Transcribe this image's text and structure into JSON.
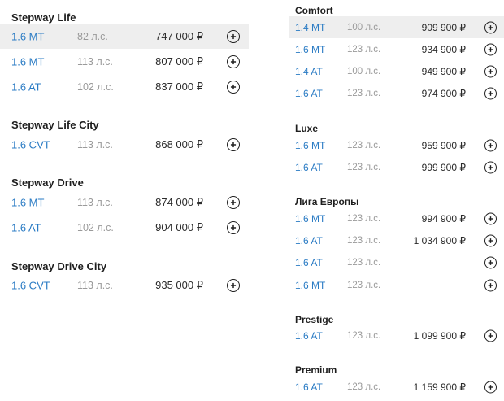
{
  "left_groups": [
    {
      "title": "Stepway Life",
      "rows": [
        {
          "engine": "1.6 MT",
          "power": "82 л.с.",
          "price": "747 000 ₽",
          "highlighted": true
        },
        {
          "engine": "1.6 MT",
          "power": "113 л.с.",
          "price": "807 000 ₽"
        },
        {
          "engine": "1.6 AT",
          "power": "102 л.с.",
          "price": "837 000 ₽"
        }
      ]
    },
    {
      "title": "Stepway Life City",
      "rows": [
        {
          "engine": "1.6 CVT",
          "power": "113 л.с.",
          "price": "868 000 ₽"
        }
      ]
    },
    {
      "title": "Stepway Drive",
      "rows": [
        {
          "engine": "1.6 MT",
          "power": "113 л.с.",
          "price": "874 000 ₽"
        },
        {
          "engine": "1.6 AT",
          "power": "102 л.с.",
          "price": "904 000 ₽"
        }
      ]
    },
    {
      "title": "Stepway Drive City",
      "rows": [
        {
          "engine": "1.6 CVT",
          "power": "113 л.с.",
          "price": "935 000 ₽"
        }
      ]
    }
  ],
  "right_groups": [
    {
      "title": "Comfort",
      "rows": [
        {
          "engine": "1.4 MT",
          "power": "100 л.с.",
          "price": "909 900 ₽",
          "highlighted": true
        },
        {
          "engine": "1.6 MT",
          "power": "123 л.с.",
          "price": "934 900 ₽"
        },
        {
          "engine": "1.4 AT",
          "power": "100 л.с.",
          "price": "949 900 ₽"
        },
        {
          "engine": "1.6 AT",
          "power": "123 л.с.",
          "price": "974 900 ₽"
        }
      ]
    },
    {
      "title": "Luxe",
      "rows": [
        {
          "engine": "1.6 MT",
          "power": "123 л.с.",
          "price": "959 900 ₽"
        },
        {
          "engine": "1.6 AT",
          "power": "123 л.с.",
          "price": "999 900 ₽"
        }
      ]
    },
    {
      "title": "Лига Европы",
      "rows": [
        {
          "engine": "1.6 MT",
          "power": "123 л.с.",
          "price": "994 900 ₽"
        },
        {
          "engine": "1.6 AT",
          "power": "123 л.с.",
          "price": "1 034 900 ₽"
        },
        {
          "engine": "1.6 AT",
          "power": "123 л.с.",
          "price": ""
        },
        {
          "engine": "1.6 MT",
          "power": "123 л.с.",
          "price": ""
        }
      ]
    },
    {
      "title": "Prestige",
      "rows": [
        {
          "engine": "1.6 AT",
          "power": "123 л.с.",
          "price": "1 099 900 ₽"
        }
      ]
    },
    {
      "title": "Premium",
      "rows": [
        {
          "engine": "1.6 AT",
          "power": "123 л.с.",
          "price": "1 159 900 ₽"
        }
      ]
    }
  ],
  "icons": {
    "add": "plus-circle-icon"
  },
  "colors": {
    "engine_link": "#2a7bc4",
    "power_text": "#9a9a9a",
    "price_text": "#2b2b2b",
    "row_highlight": "#eeeeee"
  }
}
